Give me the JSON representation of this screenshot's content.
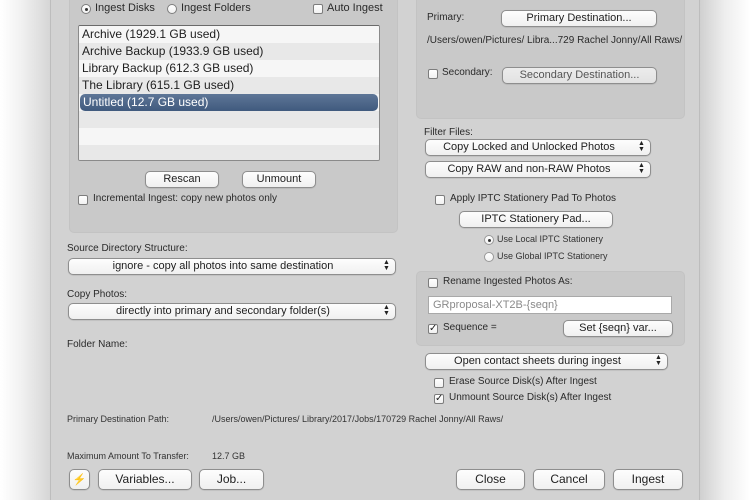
{
  "source": {
    "mode_options": [
      {
        "label": "Ingest Disks",
        "selected": true
      },
      {
        "label": "Ingest Folders",
        "selected": false
      }
    ],
    "auto_ingest": {
      "label": "Auto Ingest",
      "checked": false
    },
    "disks": [
      {
        "label": "Archive   (1929.1 GB used)",
        "selected": false
      },
      {
        "label": "Archive Backup   (1933.9 GB used)",
        "selected": false
      },
      {
        "label": "Library Backup   (612.3 GB used)",
        "selected": false
      },
      {
        "label": "The Library   (615.1 GB used)",
        "selected": false
      },
      {
        "label": "Untitled   (12.7 GB used)",
        "selected": true
      }
    ],
    "rescan_label": "Rescan",
    "unmount_label": "Unmount",
    "incremental": {
      "label": "Incremental Ingest: copy new photos only",
      "checked": false
    }
  },
  "destination": {
    "primary_label": "Primary:",
    "primary_button": "Primary Destination...",
    "primary_path": "/Users/owen/Pictures/ Libra...729 Rachel Jonny/All Raws/",
    "secondary": {
      "label": "Secondary:",
      "checked": false
    },
    "secondary_button": "Secondary Destination..."
  },
  "filter": {
    "label": "Filter Files:",
    "locked_popup": "Copy Locked and Unlocked Photos",
    "raw_popup": "Copy RAW and non-RAW Photos"
  },
  "iptc": {
    "apply": {
      "label": "Apply IPTC Stationery Pad To Photos",
      "checked": false
    },
    "pad_button": "IPTC Stationery Pad...",
    "options": [
      {
        "label": "Use Local IPTC Stationery",
        "selected": true
      },
      {
        "label": "Use Global IPTC Stationery",
        "selected": false
      }
    ]
  },
  "rename": {
    "enable": {
      "label": "Rename Ingested Photos As:",
      "checked": false
    },
    "pattern": "GRproposal-XT2B-{seqn}",
    "sequence": {
      "label": "Sequence =",
      "checked": true
    },
    "set_seqn_button": "Set {seqn} var..."
  },
  "contact_sheets_popup": "Open contact sheets during ingest",
  "erase": {
    "label": "Erase Source Disk(s) After Ingest",
    "checked": false
  },
  "unmount_after": {
    "label": "Unmount Source Disk(s) After Ingest",
    "checked": true
  },
  "structure": {
    "label": "Source Directory Structure:",
    "value": "ignore - copy all photos into same destination"
  },
  "copy_photos": {
    "label": "Copy Photos:",
    "value": "directly into primary and secondary folder(s)"
  },
  "folder_name_label": "Folder Name:",
  "primary_dest_path": {
    "label": "Primary Destination Path:",
    "value": "/Users/owen/Pictures/ Library/2017/Jobs/170729 Rachel Jonny/All Raws/"
  },
  "max_transfer": {
    "label": "Maximum Amount To Transfer:",
    "value": "12.7 GB"
  },
  "footer": {
    "lightning_icon": "⚡",
    "variables_button": "Variables...",
    "job_button": "Job...",
    "close_button": "Close",
    "cancel_button": "Cancel",
    "ingest_button": "Ingest"
  }
}
